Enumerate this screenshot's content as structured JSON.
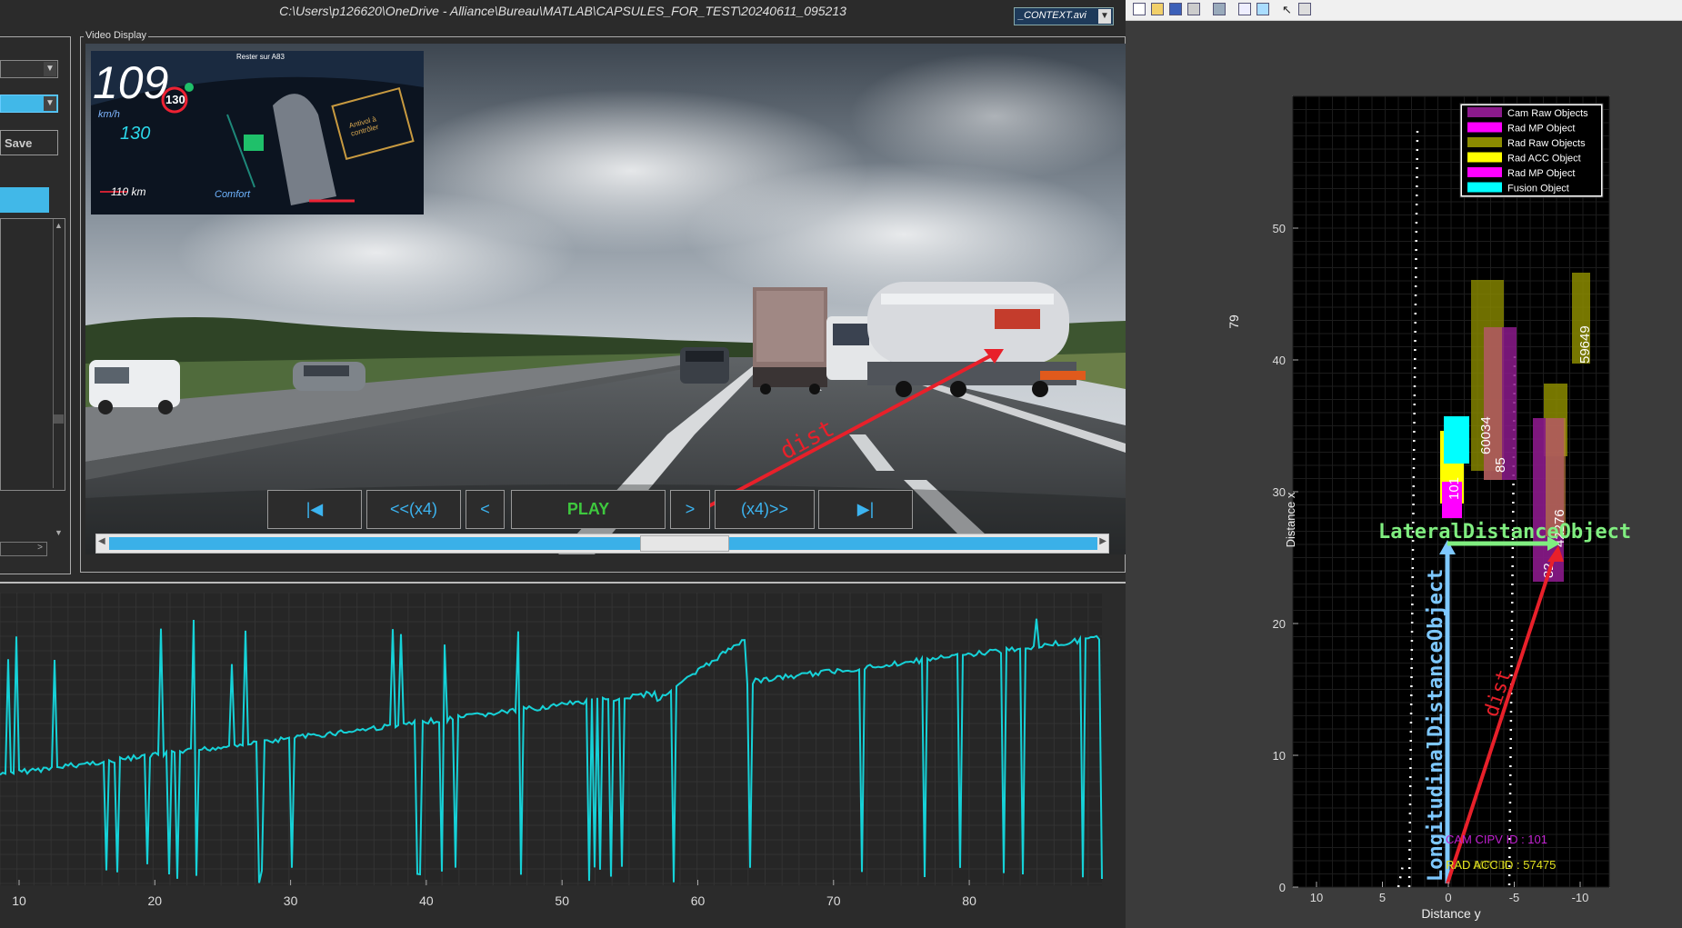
{
  "window": {
    "title": "C:\\Users\\p126620\\OneDrive - Alliance\\Bureau\\MATLAB\\CAPSULES_FOR_TEST\\20240611_095213",
    "video_file": "_CONTEXT.avi"
  },
  "controls": {
    "save_label": "Save"
  },
  "video_display": {
    "label": "Video Display",
    "dash": {
      "speed": "109",
      "speed_unit": "km/h",
      "limit": "130",
      "set_speed": "130",
      "range": "110 km",
      "mode": "Comfort",
      "nav_text": "Rester sur A83",
      "warning": "Antivol à contrôler"
    },
    "overlay_label": "dist"
  },
  "transport": {
    "buttons": [
      {
        "name": "skip-start-button",
        "label": "|◀"
      },
      {
        "name": "rewind-x4-button",
        "label": "<<(x4)"
      },
      {
        "name": "step-back-button",
        "label": "<"
      },
      {
        "name": "play-button",
        "label": "PLAY"
      },
      {
        "name": "step-forward-button",
        "label": ">"
      },
      {
        "name": "forward-x4-button",
        "label": "(x4)>>"
      },
      {
        "name": "skip-end-button",
        "label": "▶|"
      }
    ],
    "position": 0.59
  },
  "signal_plot": {
    "x_ticks": [
      "10",
      "20",
      "30",
      "40",
      "50",
      "60",
      "70",
      "80"
    ],
    "color": "#16d2d8"
  },
  "figure": {
    "side_number": "79",
    "legend": [
      {
        "label": "Cam Raw Objects",
        "color": "#8b1a8b"
      },
      {
        "label": "Rad MP Object",
        "color": "#ff00ff"
      },
      {
        "label": "Rad Raw Objects",
        "color": "#8b8b00"
      },
      {
        "label": "Rad ACC Object",
        "color": "#ffff00"
      },
      {
        "label": "Rad MP Object",
        "color": "#ff00ff"
      },
      {
        "label": "Fusion Object",
        "color": "#00ffff"
      }
    ],
    "xlabel": "Distance x",
    "ylabel": "Distance y",
    "x_ticks": [
      "0",
      "10",
      "20",
      "30",
      "40",
      "50"
    ],
    "y_ticks": [
      "10",
      "5",
      "0",
      "-5",
      "-10"
    ],
    "object_ids": [
      "60034",
      "85",
      "59649",
      "42276",
      "82",
      "101"
    ],
    "lateral_label": "LateralDistanceObject",
    "longitudinal_label": "LongitudinalDistanceObject",
    "dist_label": "dist",
    "cam_cipv": "CAM CIPV ID : 101",
    "rad_acc": "RAD ACC ID : 57475",
    "rad_mp": "RAD MP ID :"
  }
}
